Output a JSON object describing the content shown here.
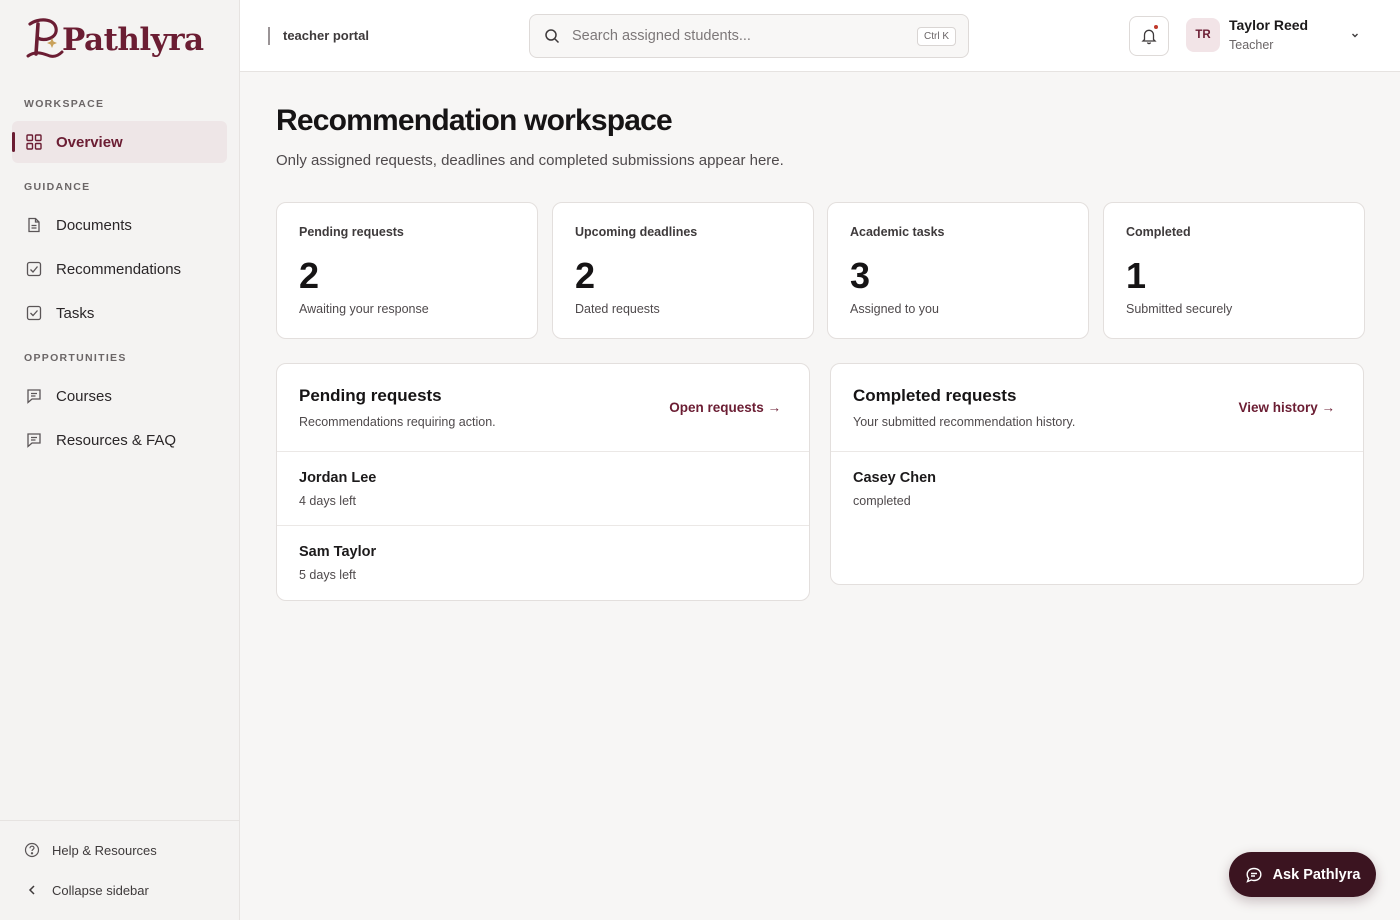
{
  "brand": {
    "name": "Pathlyra",
    "accent": "#6b1d33",
    "dark": "#3b1420"
  },
  "sidebar": {
    "sections": [
      {
        "label": "WORKSPACE",
        "items": [
          {
            "label": "Overview",
            "icon": "grid-icon",
            "active": true
          }
        ]
      },
      {
        "label": "GUIDANCE",
        "items": [
          {
            "label": "Documents",
            "icon": "document-icon"
          },
          {
            "label": "Recommendations",
            "icon": "check-square-icon"
          },
          {
            "label": "Tasks",
            "icon": "checkbox-icon"
          }
        ]
      },
      {
        "label": "OPPORTUNITIES",
        "items": [
          {
            "label": "Courses",
            "icon": "note-icon"
          },
          {
            "label": "Resources & FAQ",
            "icon": "note-icon"
          }
        ]
      }
    ],
    "footer": {
      "help": "Help & Resources",
      "collapse": "Collapse sidebar"
    }
  },
  "topbar": {
    "portal": "teacher portal",
    "search": {
      "placeholder": "Search assigned students...",
      "shortcut": "Ctrl K"
    },
    "user": {
      "initials": "TR",
      "name": "Taylor Reed",
      "role": "Teacher"
    }
  },
  "main": {
    "title": "Recommendation workspace",
    "subtitle": "Only assigned requests, deadlines and completed submissions appear here.",
    "stats": [
      {
        "label": "Pending requests",
        "value": "2",
        "sub": "Awaiting your response"
      },
      {
        "label": "Upcoming deadlines",
        "value": "2",
        "sub": "Dated requests"
      },
      {
        "label": "Academic tasks",
        "value": "3",
        "sub": "Assigned to you"
      },
      {
        "label": "Completed",
        "value": "1",
        "sub": "Submitted securely"
      }
    ],
    "pending": {
      "title": "Pending requests",
      "subtitle": "Recommendations requiring action.",
      "link": "Open requests →",
      "rows": [
        {
          "name": "Jordan Lee",
          "meta": "4 days left"
        },
        {
          "name": "Sam Taylor",
          "meta": "5 days left"
        }
      ]
    },
    "completed": {
      "title": "Completed requests",
      "subtitle": "Your submitted recommendation history.",
      "link": "View history →",
      "rows": [
        {
          "name": "Casey Chen",
          "meta": "completed"
        }
      ]
    }
  },
  "assistant": {
    "label": "Ask Pathlyra"
  }
}
